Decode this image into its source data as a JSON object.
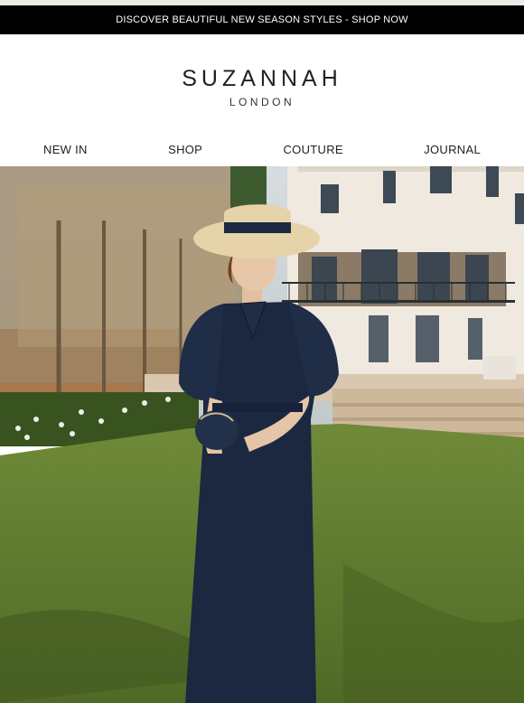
{
  "promo": {
    "text": "DISCOVER BEAUTIFUL NEW SEASON STYLES - SHOP NOW"
  },
  "brand": {
    "name": "SUZANNAH",
    "sub": "LONDON"
  },
  "nav": {
    "items": [
      {
        "label": "NEW IN"
      },
      {
        "label": "SHOP"
      },
      {
        "label": "COUTURE"
      },
      {
        "label": "JOURNAL"
      }
    ]
  },
  "hero": {
    "colors": {
      "sky": "#c9d2d8",
      "house": "#efe9df",
      "lawn": "#5f7c2f",
      "dress": "#1b2840",
      "hat": "#e6d3a9"
    }
  }
}
